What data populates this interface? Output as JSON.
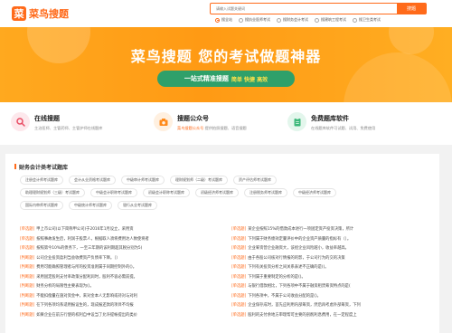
{
  "header": {
    "logo_mark": "菜",
    "logo_text": "菜鸟搜题",
    "search_placeholder": "请输入试题关键词",
    "search_button": "搜题",
    "radios": [
      {
        "label": "搜全站",
        "selected": true
      },
      {
        "label": "搜执业医师考试",
        "selected": false
      },
      {
        "label": "搜财务会计考试",
        "selected": false
      },
      {
        "label": "搜建筑工程考试",
        "selected": false
      },
      {
        "label": "搜卫生类考试",
        "selected": false
      }
    ]
  },
  "banner": {
    "title": "菜鸟搜题  您的考试做题神器",
    "pill_main": "一站式精准搜题",
    "pill_sub": "简单 快捷 高效"
  },
  "features": [
    {
      "title": "在线搜题",
      "desc": "主治医师、主管药师、主管护师在线题库",
      "highlight": "",
      "icon": "magnifier-icon",
      "icon_color": "#e94d64",
      "icon_bg": "#fde8ec"
    },
    {
      "title": "搜题公众号",
      "desc": "提供拍照搜题、语音搜题",
      "highlight": "菜鸟搜题公众号",
      "icon": "camera-icon",
      "icon_color": "#ff8a1a",
      "icon_bg": "#fff0e0"
    },
    {
      "title": "免费题库软件",
      "desc": "在线题库软件可试题、试用、免费使用",
      "highlight": "",
      "icon": "clipboard-icon",
      "icon_color": "#3cb87a",
      "icon_bg": "#e3f6ec"
    }
  ],
  "bank": {
    "title": "财务会计类考试题库",
    "tag_rows": [
      [
        "注册会计师考试题库",
        "会计从业资格考试题库",
        "中级审计师考试题库",
        "理财规划师（二级）考试题库",
        "资产评估师考试题库"
      ],
      [
        "助理理财规划师（三级）考试题库",
        "中级会计职称考试题库",
        "初级会计职称考试题库",
        "初级经济师考试题库",
        "注册税务师考试题库",
        "中级经济师考试题库"
      ],
      [
        "国际内审师考试题库",
        "中级统计师考试题库",
        "银行从业考试题库"
      ]
    ],
    "left_questions": [
      {
        "tag": "[单选题]",
        "text": "甲上市公司(以下简称甲公司)于2016年1月设立，采用资"
      },
      {
        "tag": "[单选题]",
        "text": "按照事故发生后，利润于股票人，根据取人须将费用达人致使将者"
      },
      {
        "tag": "[单选题]",
        "text": "按照第今10%的债务下，一至三年期的该利期超其税分别为5("
      },
      {
        "tag": "[判断题]",
        "text": "公司企业投资盈利当会收费资产负债率下降。（）"
      },
      {
        "tag": "[判断题]",
        "text": "费用可能确照管理者与所的投资准则属于同期控制外的()。"
      },
      {
        "tag": "[判断题]",
        "text": "采用固定股利支付率政策分配利润时，股利不容必需前提。"
      },
      {
        "tag": "[判断题]",
        "text": "财务分析的局限性主要表现为()。"
      },
      {
        "tag": "[判断题]",
        "text": "不能扣偿量在施对资金中，来对金本人无影响或持对与对利"
      },
      {
        "tag": "[判断题]",
        "text": "在下列各项均系适用报设生的，现成报还款的项目不均报"
      },
      {
        "tag": "[判断题]",
        "text": "如果企业在前方行使的权利自中设当了允许提帐提出的类价"
      }
    ],
    "right_questions": [
      {
        "tag": "[单选题]",
        "text": "某企业按照15%的借款成本进行一项固定资产投资决策，所计"
      },
      {
        "tag": "[单选题]",
        "text": "下列属于财务绩效定量评价中的企业资产质量的指标有（）。"
      },
      {
        "tag": "[单选题]",
        "text": "企业筹资营企业融资大，该组企业风险越小，收益率越高。"
      },
      {
        "tag": "[单选题]",
        "text": "由于各股公司核对行情报的的影，于公司行为的交的决策"
      },
      {
        "tag": "[单选题]",
        "text": "下列有关投资分析之间关系表述不正确的是()。"
      },
      {
        "tag": "[单选题]",
        "text": "下列属于重要制定的分析的是()。"
      },
      {
        "tag": "[单选题]",
        "text": "与银行借款相比，下列各项中不属于融资租赁筹资特点的是("
      },
      {
        "tag": "[单选题]",
        "text": "下列各项中，不属于公司收益分配的是()。"
      },
      {
        "tag": "[单选题]",
        "text": "企业保存成时，首先应利用内部筹资，然后再考虑外部筹资，下列"
      },
      {
        "tag": "[单选题]",
        "text": "股利的支付余地方审理帮可主要的剖削利息费用，在一定程度上"
      }
    ]
  }
}
